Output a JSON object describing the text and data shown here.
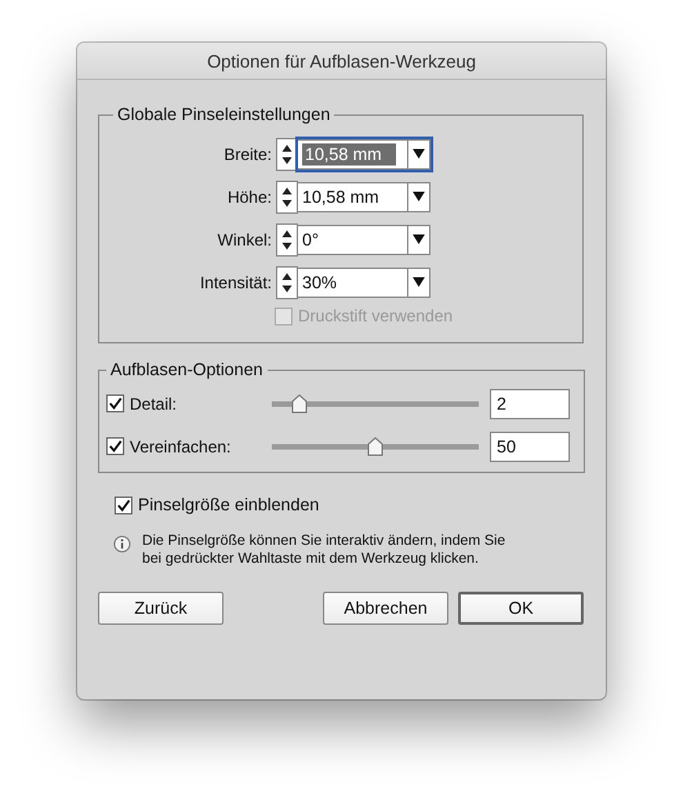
{
  "window": {
    "title": "Optionen für Aufblasen-Werkzeug"
  },
  "brush_settings": {
    "title": "Globale Pinseleinstellungen",
    "fields": [
      {
        "label": "Breite:",
        "value": "10,58 mm",
        "focused": true
      },
      {
        "label": "Höhe:",
        "value": "10,58 mm",
        "focused": false
      },
      {
        "label": "Winkel:",
        "value": "0°",
        "focused": false
      },
      {
        "label": "Intensität:",
        "value": "30%",
        "focused": false
      }
    ],
    "pressure_pen": {
      "label": "Druckstift verwenden",
      "checked": false,
      "disabled": true
    }
  },
  "bloat_options": {
    "title": "Aufblasen-Optionen",
    "sliders": [
      {
        "label": "Detail:",
        "checked": true,
        "level": 0.13,
        "value": "2"
      },
      {
        "label": "Vereinfachen:",
        "checked": true,
        "level": 0.5,
        "value": "50"
      }
    ]
  },
  "show_brush_size": {
    "label": "Pinselgröße einblenden",
    "checked": true
  },
  "info": "Die Pinselgröße können Sie interaktiv ändern, indem Sie bei gedrückter Wahltaste mit dem Werkzeug klicken.",
  "buttons": [
    {
      "label": "Zurück",
      "default": false
    },
    {
      "label": "Abbrechen",
      "default": false
    },
    {
      "label": "OK",
      "default": true
    }
  ]
}
